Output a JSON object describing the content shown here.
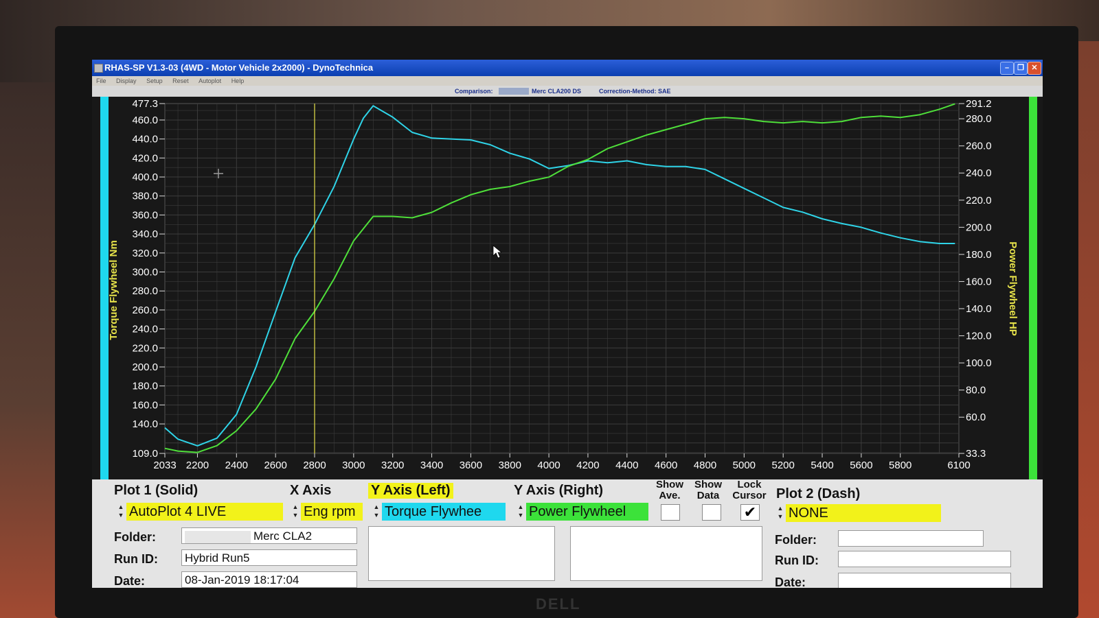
{
  "window": {
    "title": "RHAS-SP V1.3-03  (4WD - Motor Vehicle 2x2000) - DynoTechnica",
    "min_icon": "minimize-icon",
    "max_icon": "maximize-icon",
    "close_icon": "close-icon"
  },
  "menu": [
    "File",
    "Display",
    "Setup",
    "Reset",
    "Autoplot",
    "Help"
  ],
  "info": {
    "comparison_label": "Comparison:",
    "comparison_name": "Merc CLA200 DS",
    "correction": "Correction-Method: SAE"
  },
  "colors": {
    "chart_bg": "#181818",
    "grid": "#3c3c3c",
    "torque": "#2fd4e8",
    "power": "#4fe03a",
    "cursor": "#e6e24a",
    "axis_text": "#ffffff",
    "left_axis_title": "#e6e24a",
    "right_axis_title": "#e6e24a",
    "yellow_select": "#f2f21a",
    "cyan_select": "#1fd8ee",
    "green_select": "#3ce23a"
  },
  "chart_data": {
    "type": "line",
    "xlabel": "",
    "ylabel_left": "Torque Flywheel Nm",
    "ylabel_right": "Power Flywheel HP",
    "xlim": [
      2033,
      6100
    ],
    "ylim_left": [
      109.0,
      477.3
    ],
    "ylim_right": [
      33.3,
      291.2
    ],
    "x_ticks": [
      "2033",
      "2200",
      "2400",
      "2600",
      "2800",
      "3000",
      "3200",
      "3400",
      "3600",
      "3800",
      "4000",
      "4200",
      "4400",
      "4600",
      "4800",
      "5000",
      "5200",
      "5400",
      "5600",
      "5800",
      "6100"
    ],
    "y_left_ticks": [
      "477.3",
      "460.0",
      "440.0",
      "420.0",
      "400.0",
      "380.0",
      "360.0",
      "340.0",
      "320.0",
      "300.0",
      "280.0",
      "260.0",
      "240.0",
      "220.0",
      "200.0",
      "180.0",
      "160.0",
      "140.0",
      "109.0"
    ],
    "y_right_ticks": [
      "291.2",
      "280.0",
      "260.0",
      "240.0",
      "220.0",
      "200.0",
      "180.0",
      "160.0",
      "140.0",
      "120.0",
      "100.0",
      "80.0",
      "60.0",
      "33.3"
    ],
    "cursor_x": 2800,
    "grid": true,
    "series": [
      {
        "name": "Torque Flywheel",
        "axis": "left",
        "x": [
          2033,
          2100,
          2200,
          2300,
          2400,
          2500,
          2600,
          2700,
          2800,
          2900,
          3000,
          3050,
          3100,
          3200,
          3300,
          3400,
          3600,
          3700,
          3800,
          3900,
          4000,
          4100,
          4200,
          4300,
          4400,
          4500,
          4600,
          4700,
          4800,
          4900,
          5000,
          5100,
          5200,
          5300,
          5400,
          5500,
          5600,
          5700,
          5800,
          5900,
          6000,
          6080
        ],
        "y": [
          136,
          124,
          117,
          125,
          150,
          200,
          258,
          315,
          350,
          390,
          440,
          462,
          475,
          463,
          447,
          441,
          439,
          434,
          425,
          419,
          409,
          412,
          417,
          415,
          417,
          413,
          411,
          411,
          408,
          398,
          388,
          378,
          368,
          363,
          356,
          351,
          347,
          341,
          336,
          332,
          330,
          330
        ]
      },
      {
        "name": "Power Flywheel",
        "axis": "right",
        "x": [
          2033,
          2100,
          2200,
          2300,
          2400,
          2500,
          2600,
          2700,
          2800,
          2900,
          3000,
          3100,
          3200,
          3300,
          3400,
          3500,
          3600,
          3700,
          3800,
          3900,
          4000,
          4100,
          4200,
          4300,
          4400,
          4500,
          4600,
          4700,
          4800,
          4900,
          5000,
          5100,
          5200,
          5300,
          5400,
          5500,
          5600,
          5700,
          5800,
          5900,
          6000,
          6080
        ],
        "y": [
          37,
          35,
          34,
          39,
          50,
          66,
          88,
          118,
          138,
          162,
          190,
          208,
          208,
          207,
          211,
          218,
          224,
          228,
          230,
          234,
          237,
          245,
          250,
          258,
          263,
          268,
          272,
          276,
          280,
          281,
          280,
          278,
          277,
          278,
          277,
          278,
          281,
          282,
          281,
          283,
          287,
          291
        ]
      }
    ]
  },
  "panel": {
    "plot1_label": "Plot 1 (Solid)",
    "x_axis_label": "X Axis",
    "y_left_label": "Y Axis (Left)",
    "y_right_label": "Y Axis (Right)",
    "show_ave_label": "Show Ave.",
    "show_data_label": "Show Data",
    "lock_cursor_label": "Lock Cursor",
    "plot2_label": "Plot 2 (Dash)",
    "plot1_select": "AutoPlot 4 LIVE",
    "x_axis_select": "Eng rpm",
    "y_left_select": "Torque Flywhee",
    "y_right_select": "Power Flywheel",
    "plot2_select": "NONE",
    "show_ave_checked": "",
    "show_data_checked": "",
    "lock_cursor_checked": "✔",
    "folder_label": "Folder:",
    "run_id_label": "Run ID:",
    "date_label": "Date:",
    "folder_value": "Merc CLA2",
    "run_id_value": "Hybrid Run5",
    "date_value": "08-Jan-2019  18:17:04",
    "folder2_value": "",
    "run_id2_value": "",
    "date2_value": ""
  },
  "stand_logo": "DELL"
}
